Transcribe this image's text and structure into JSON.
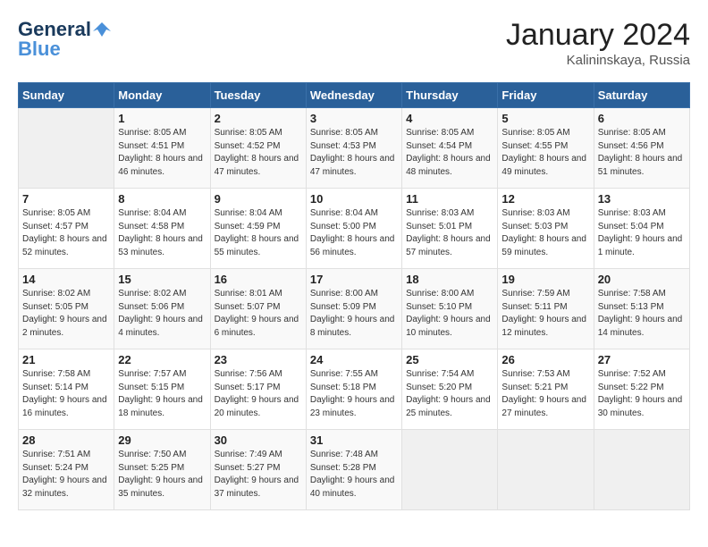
{
  "app": {
    "name_general": "General",
    "name_blue": "Blue",
    "month": "January 2024",
    "location": "Kalininskaya, Russia"
  },
  "weekdays": [
    "Sunday",
    "Monday",
    "Tuesday",
    "Wednesday",
    "Thursday",
    "Friday",
    "Saturday"
  ],
  "weeks": [
    [
      {
        "day": "",
        "sunrise": "",
        "sunset": "",
        "daylight": ""
      },
      {
        "day": "1",
        "sunrise": "Sunrise: 8:05 AM",
        "sunset": "Sunset: 4:51 PM",
        "daylight": "Daylight: 8 hours and 46 minutes."
      },
      {
        "day": "2",
        "sunrise": "Sunrise: 8:05 AM",
        "sunset": "Sunset: 4:52 PM",
        "daylight": "Daylight: 8 hours and 47 minutes."
      },
      {
        "day": "3",
        "sunrise": "Sunrise: 8:05 AM",
        "sunset": "Sunset: 4:53 PM",
        "daylight": "Daylight: 8 hours and 47 minutes."
      },
      {
        "day": "4",
        "sunrise": "Sunrise: 8:05 AM",
        "sunset": "Sunset: 4:54 PM",
        "daylight": "Daylight: 8 hours and 48 minutes."
      },
      {
        "day": "5",
        "sunrise": "Sunrise: 8:05 AM",
        "sunset": "Sunset: 4:55 PM",
        "daylight": "Daylight: 8 hours and 49 minutes."
      },
      {
        "day": "6",
        "sunrise": "Sunrise: 8:05 AM",
        "sunset": "Sunset: 4:56 PM",
        "daylight": "Daylight: 8 hours and 51 minutes."
      }
    ],
    [
      {
        "day": "7",
        "sunrise": "Sunrise: 8:05 AM",
        "sunset": "Sunset: 4:57 PM",
        "daylight": "Daylight: 8 hours and 52 minutes."
      },
      {
        "day": "8",
        "sunrise": "Sunrise: 8:04 AM",
        "sunset": "Sunset: 4:58 PM",
        "daylight": "Daylight: 8 hours and 53 minutes."
      },
      {
        "day": "9",
        "sunrise": "Sunrise: 8:04 AM",
        "sunset": "Sunset: 4:59 PM",
        "daylight": "Daylight: 8 hours and 55 minutes."
      },
      {
        "day": "10",
        "sunrise": "Sunrise: 8:04 AM",
        "sunset": "Sunset: 5:00 PM",
        "daylight": "Daylight: 8 hours and 56 minutes."
      },
      {
        "day": "11",
        "sunrise": "Sunrise: 8:03 AM",
        "sunset": "Sunset: 5:01 PM",
        "daylight": "Daylight: 8 hours and 57 minutes."
      },
      {
        "day": "12",
        "sunrise": "Sunrise: 8:03 AM",
        "sunset": "Sunset: 5:03 PM",
        "daylight": "Daylight: 8 hours and 59 minutes."
      },
      {
        "day": "13",
        "sunrise": "Sunrise: 8:03 AM",
        "sunset": "Sunset: 5:04 PM",
        "daylight": "Daylight: 9 hours and 1 minute."
      }
    ],
    [
      {
        "day": "14",
        "sunrise": "Sunrise: 8:02 AM",
        "sunset": "Sunset: 5:05 PM",
        "daylight": "Daylight: 9 hours and 2 minutes."
      },
      {
        "day": "15",
        "sunrise": "Sunrise: 8:02 AM",
        "sunset": "Sunset: 5:06 PM",
        "daylight": "Daylight: 9 hours and 4 minutes."
      },
      {
        "day": "16",
        "sunrise": "Sunrise: 8:01 AM",
        "sunset": "Sunset: 5:07 PM",
        "daylight": "Daylight: 9 hours and 6 minutes."
      },
      {
        "day": "17",
        "sunrise": "Sunrise: 8:00 AM",
        "sunset": "Sunset: 5:09 PM",
        "daylight": "Daylight: 9 hours and 8 minutes."
      },
      {
        "day": "18",
        "sunrise": "Sunrise: 8:00 AM",
        "sunset": "Sunset: 5:10 PM",
        "daylight": "Daylight: 9 hours and 10 minutes."
      },
      {
        "day": "19",
        "sunrise": "Sunrise: 7:59 AM",
        "sunset": "Sunset: 5:11 PM",
        "daylight": "Daylight: 9 hours and 12 minutes."
      },
      {
        "day": "20",
        "sunrise": "Sunrise: 7:58 AM",
        "sunset": "Sunset: 5:13 PM",
        "daylight": "Daylight: 9 hours and 14 minutes."
      }
    ],
    [
      {
        "day": "21",
        "sunrise": "Sunrise: 7:58 AM",
        "sunset": "Sunset: 5:14 PM",
        "daylight": "Daylight: 9 hours and 16 minutes."
      },
      {
        "day": "22",
        "sunrise": "Sunrise: 7:57 AM",
        "sunset": "Sunset: 5:15 PM",
        "daylight": "Daylight: 9 hours and 18 minutes."
      },
      {
        "day": "23",
        "sunrise": "Sunrise: 7:56 AM",
        "sunset": "Sunset: 5:17 PM",
        "daylight": "Daylight: 9 hours and 20 minutes."
      },
      {
        "day": "24",
        "sunrise": "Sunrise: 7:55 AM",
        "sunset": "Sunset: 5:18 PM",
        "daylight": "Daylight: 9 hours and 23 minutes."
      },
      {
        "day": "25",
        "sunrise": "Sunrise: 7:54 AM",
        "sunset": "Sunset: 5:20 PM",
        "daylight": "Daylight: 9 hours and 25 minutes."
      },
      {
        "day": "26",
        "sunrise": "Sunrise: 7:53 AM",
        "sunset": "Sunset: 5:21 PM",
        "daylight": "Daylight: 9 hours and 27 minutes."
      },
      {
        "day": "27",
        "sunrise": "Sunrise: 7:52 AM",
        "sunset": "Sunset: 5:22 PM",
        "daylight": "Daylight: 9 hours and 30 minutes."
      }
    ],
    [
      {
        "day": "28",
        "sunrise": "Sunrise: 7:51 AM",
        "sunset": "Sunset: 5:24 PM",
        "daylight": "Daylight: 9 hours and 32 minutes."
      },
      {
        "day": "29",
        "sunrise": "Sunrise: 7:50 AM",
        "sunset": "Sunset: 5:25 PM",
        "daylight": "Daylight: 9 hours and 35 minutes."
      },
      {
        "day": "30",
        "sunrise": "Sunrise: 7:49 AM",
        "sunset": "Sunset: 5:27 PM",
        "daylight": "Daylight: 9 hours and 37 minutes."
      },
      {
        "day": "31",
        "sunrise": "Sunrise: 7:48 AM",
        "sunset": "Sunset: 5:28 PM",
        "daylight": "Daylight: 9 hours and 40 minutes."
      },
      {
        "day": "",
        "sunrise": "",
        "sunset": "",
        "daylight": ""
      },
      {
        "day": "",
        "sunrise": "",
        "sunset": "",
        "daylight": ""
      },
      {
        "day": "",
        "sunrise": "",
        "sunset": "",
        "daylight": ""
      }
    ]
  ]
}
